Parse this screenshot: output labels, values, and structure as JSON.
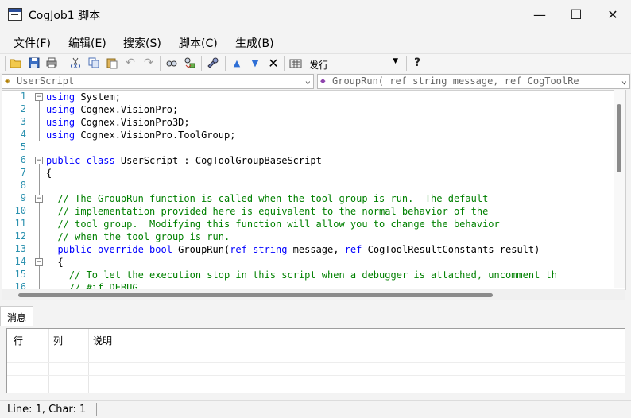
{
  "window": {
    "title": "CogJob1 脚本",
    "minimize": "—",
    "maximize": "☐",
    "close": "✕"
  },
  "menu": [
    "文件(F)",
    "编辑(E)",
    "搜索(S)",
    "脚本(C)",
    "生成(B)"
  ],
  "toolbar": {
    "icons": [
      "open-folder-icon",
      "save-icon",
      "print-icon",
      "cut-icon",
      "copy-icon",
      "paste-icon",
      "undo-icon",
      "redo-icon",
      "find-icon",
      "replace-icon",
      "build-icon",
      "move-up-icon",
      "move-down-icon",
      "delete-icon",
      "config-icon",
      "help-icon"
    ],
    "configuration": "发行"
  },
  "navbar": {
    "class_combo": "UserScript",
    "member_combo": "GroupRun( ref string message,  ref CogToolRe"
  },
  "editor": {
    "line_numbers": [
      "1",
      "2",
      "3",
      "4",
      "5",
      "6",
      "7",
      "8",
      "9",
      "10",
      "11",
      "12",
      "13",
      "14",
      "15",
      "16"
    ],
    "lines": [
      [
        [
          "kw",
          "using"
        ],
        [
          "t",
          " System;"
        ]
      ],
      [
        [
          "kw",
          "using"
        ],
        [
          "t",
          " Cognex.VisionPro;"
        ]
      ],
      [
        [
          "kw",
          "using"
        ],
        [
          "t",
          " Cognex.VisionPro3D;"
        ]
      ],
      [
        [
          "kw",
          "using"
        ],
        [
          "t",
          " Cognex.VisionPro.ToolGroup;"
        ]
      ],
      [
        [
          "t",
          ""
        ]
      ],
      [
        [
          "kw",
          "public class"
        ],
        [
          "t",
          " UserScript : CogToolGroupBaseScript"
        ]
      ],
      [
        [
          "t",
          "{"
        ]
      ],
      [
        [
          "t",
          ""
        ]
      ],
      [
        [
          "cm",
          "  // The GroupRun function is called when the tool group is run.  The default"
        ]
      ],
      [
        [
          "cm",
          "  // implementation provided here is equivalent to the normal behavior of the"
        ]
      ],
      [
        [
          "cm",
          "  // tool group.  Modifying this function will allow you to change the behavior"
        ]
      ],
      [
        [
          "cm",
          "  // when the tool group is run."
        ]
      ],
      [
        [
          "t",
          "  "
        ],
        [
          "kw",
          "public override bool"
        ],
        [
          "t",
          " GroupRun("
        ],
        [
          "kw",
          "ref string"
        ],
        [
          "t",
          " message, "
        ],
        [
          "kw",
          "ref"
        ],
        [
          "t",
          " CogToolResultConstants result)"
        ]
      ],
      [
        [
          "t",
          "  {"
        ]
      ],
      [
        [
          "cm",
          "    // To let the execution stop in this script when a debugger is attached, uncomment th"
        ]
      ],
      [
        [
          "cm",
          "    // #if DEBUG"
        ]
      ]
    ]
  },
  "messages": {
    "tab": "消息",
    "columns": [
      "行",
      "列",
      "说明"
    ],
    "rows": []
  },
  "status": {
    "position": "Line: 1, Char: 1"
  }
}
